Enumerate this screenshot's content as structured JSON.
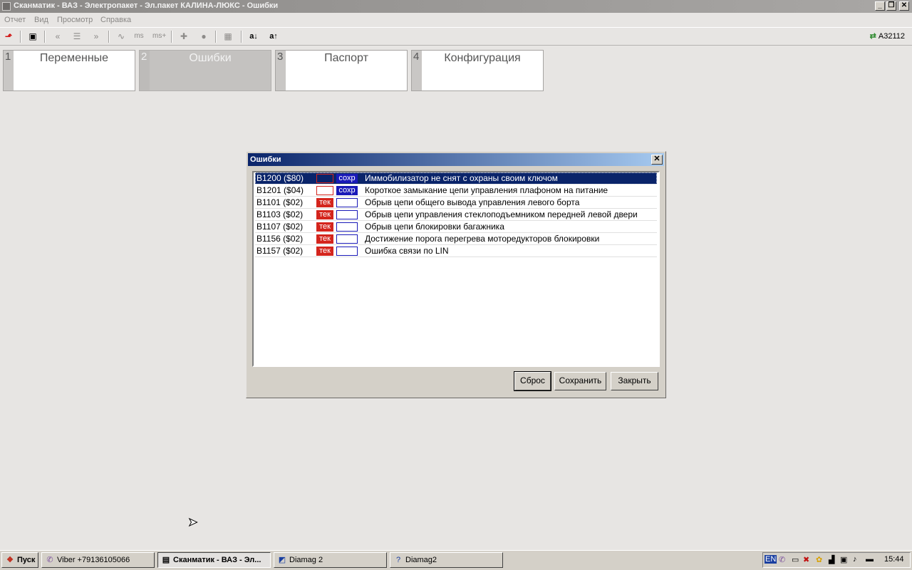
{
  "window": {
    "title": "Сканматик - ВАЗ - Электропакет - Эл.пакет КАЛИНА-ЛЮКС - Ошибки",
    "min_label": "_",
    "max_label": "❐",
    "close_label": "✕"
  },
  "menu": [
    "Отчет",
    "Вид",
    "Просмотр",
    "Справка"
  ],
  "toolbar": {
    "device_id": "A32112",
    "icons": [
      "up-arrow-red-icon",
      "notes-icon",
      "rewind-icon",
      "list-icon",
      "forward-icon",
      "wave-icon",
      "ms-icon",
      "ms-plus-icon",
      "plus-icon",
      "record-icon",
      "chart-icon",
      "font-down-icon",
      "font-up-icon"
    ],
    "ms_label": "ms",
    "ms_plus_label": "ms+",
    "font_down_label": "a↓",
    "font_up_label": "a↑"
  },
  "tabs": [
    {
      "num": "1",
      "label": "Переменные",
      "active": false
    },
    {
      "num": "2",
      "label": "Ошибки",
      "active": true
    },
    {
      "num": "3",
      "label": "Паспорт",
      "active": false
    },
    {
      "num": "4",
      "label": "Конфигурация",
      "active": false
    }
  ],
  "dialog": {
    "title": "Ошибки",
    "close_label": "✕",
    "badge_current": "тек",
    "badge_saved": "сохр",
    "errors": [
      {
        "code": "B1200 ($80)",
        "current": false,
        "saved": true,
        "description": "Иммобилизатор не снят с охраны своим ключом",
        "selected": true
      },
      {
        "code": "B1201 ($04)",
        "current": false,
        "saved": true,
        "description": "Короткое замыкание цепи управления плафоном на питание",
        "selected": false
      },
      {
        "code": "B1101 ($02)",
        "current": true,
        "saved": false,
        "description": "Обрыв цепи общего вывода управления левого борта",
        "selected": false
      },
      {
        "code": "B1103 ($02)",
        "current": true,
        "saved": false,
        "description": "Обрыв цепи управления стеклоподъемником передней левой двери",
        "selected": false
      },
      {
        "code": "B1107 ($02)",
        "current": true,
        "saved": false,
        "description": "Обрыв цепи блокировки багажника",
        "selected": false
      },
      {
        "code": "B1156 ($02)",
        "current": true,
        "saved": false,
        "description": "Достижение порога перегрева моторедукторов блокировки",
        "selected": false
      },
      {
        "code": "B1157 ($02)",
        "current": true,
        "saved": false,
        "description": "Ошибка связи по LIN",
        "selected": false
      }
    ],
    "buttons": {
      "reset": "Сброс",
      "save": "Сохранить",
      "close": "Закрыть"
    }
  },
  "taskbar": {
    "start": "Пуск",
    "items": [
      {
        "label": "Viber +79136105066",
        "icon": "viber-icon",
        "pressed": false
      },
      {
        "label": "Сканматик - ВАЗ - Эл...",
        "icon": "scanmatik-icon",
        "pressed": true
      },
      {
        "label": "Diamag 2",
        "icon": "diamag-icon",
        "pressed": false
      },
      {
        "label": "Diamag2",
        "icon": "help-icon",
        "pressed": false
      }
    ],
    "tray": {
      "lang": "EN",
      "time": "15:44"
    }
  },
  "colors": {
    "accent_selection": "#0a246a",
    "badge_current": "#d4251d",
    "badge_saved": "#1a1ab8"
  }
}
